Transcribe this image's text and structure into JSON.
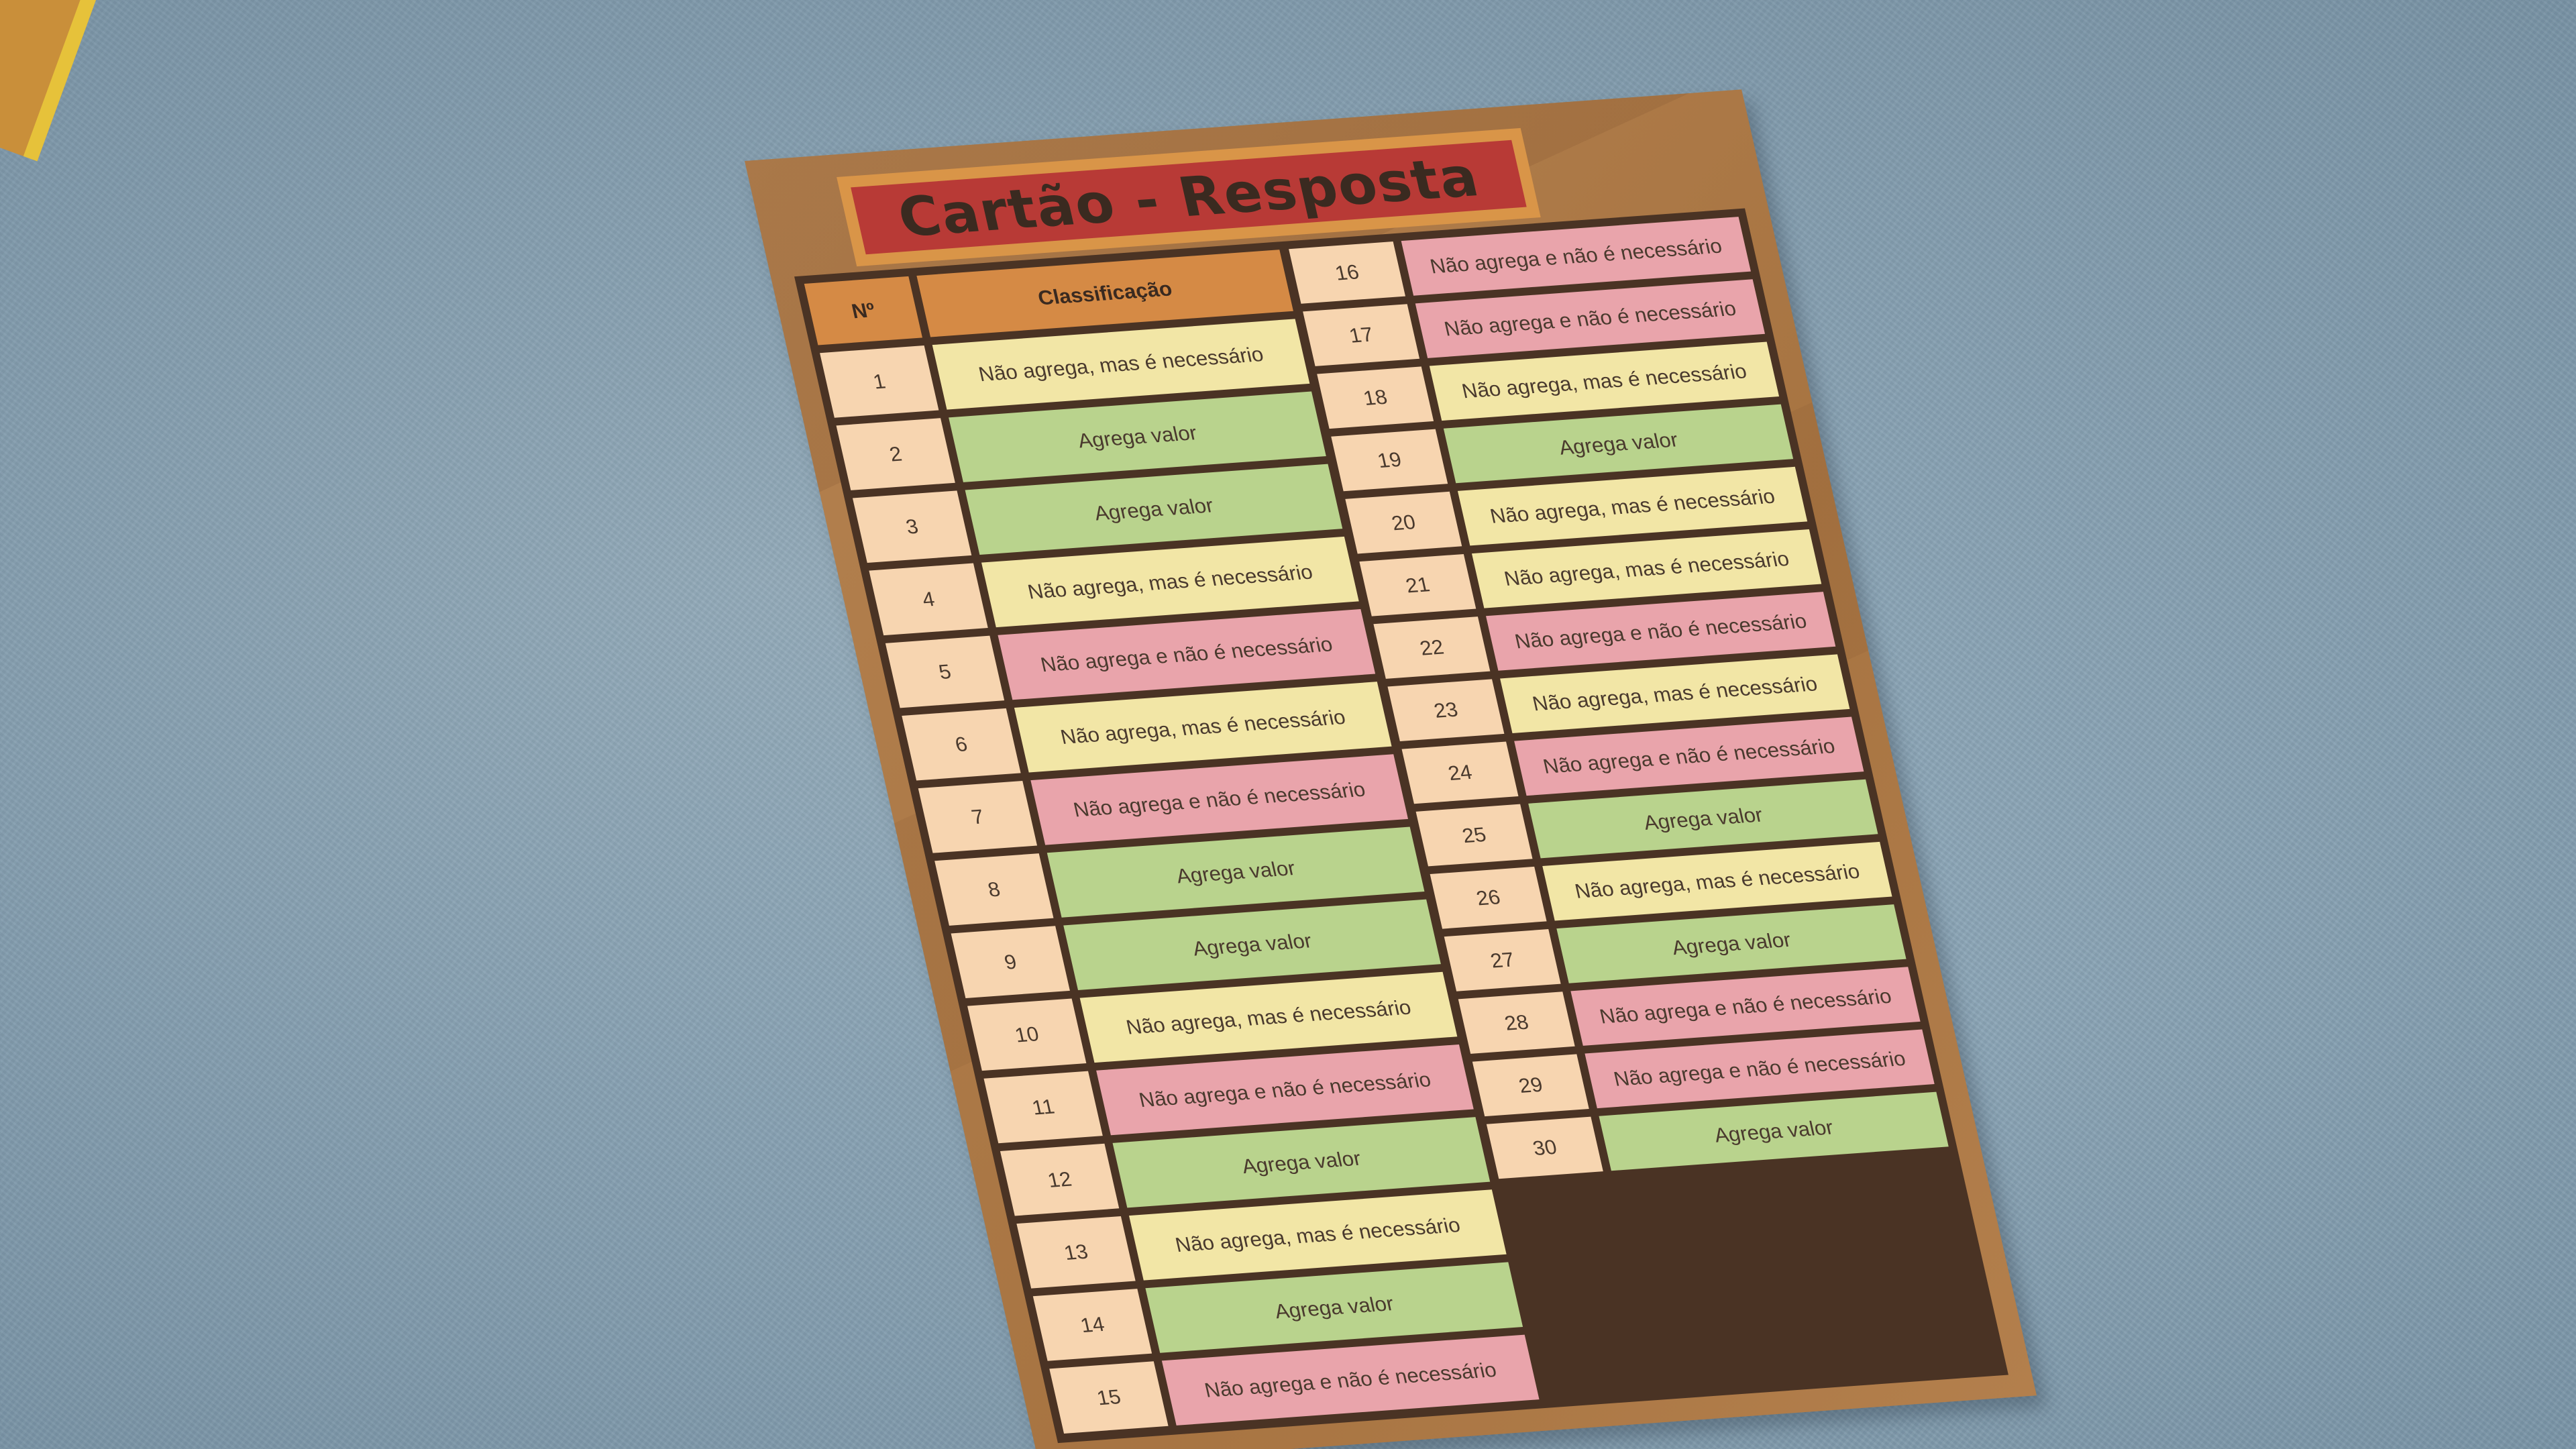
{
  "card": {
    "title": "Cartão - Resposta",
    "header_number": "Nº",
    "header_classification": "Classificação"
  },
  "categories": {
    "agrega": "Agrega valor",
    "nao_mas": "Não agrega, mas é necessário",
    "nao_nao": "Não agrega e não é necessário"
  },
  "rows_left": [
    {
      "n": "1",
      "label": "Não agrega, mas é necessário",
      "kind": "nao-mas"
    },
    {
      "n": "2",
      "label": "Agrega valor",
      "kind": "agrega"
    },
    {
      "n": "3",
      "label": "Agrega valor",
      "kind": "agrega"
    },
    {
      "n": "4",
      "label": "Não agrega, mas é necessário",
      "kind": "nao-mas"
    },
    {
      "n": "5",
      "label": "Não agrega e não é necessário",
      "kind": "nao-nao"
    },
    {
      "n": "6",
      "label": "Não agrega, mas é necessário",
      "kind": "nao-mas"
    },
    {
      "n": "7",
      "label": "Não agrega e não é necessário",
      "kind": "nao-nao"
    },
    {
      "n": "8",
      "label": "Agrega valor",
      "kind": "agrega"
    },
    {
      "n": "9",
      "label": "Agrega valor",
      "kind": "agrega"
    },
    {
      "n": "10",
      "label": "Não agrega, mas é necessário",
      "kind": "nao-mas"
    },
    {
      "n": "11",
      "label": "Não agrega e não é necessário",
      "kind": "nao-nao"
    },
    {
      "n": "12",
      "label": "Agrega valor",
      "kind": "agrega"
    },
    {
      "n": "13",
      "label": "Não agrega, mas é necessário",
      "kind": "nao-mas"
    },
    {
      "n": "14",
      "label": "Agrega valor",
      "kind": "agrega"
    },
    {
      "n": "15",
      "label": "Não agrega e não é necessário",
      "kind": "nao-nao"
    }
  ],
  "rows_right": [
    {
      "n": "16",
      "label": "Não agrega e não é necessário",
      "kind": "nao-nao"
    },
    {
      "n": "17",
      "label": "Não agrega e não é necessário",
      "kind": "nao-nao"
    },
    {
      "n": "18",
      "label": "Não agrega, mas é necessário",
      "kind": "nao-mas"
    },
    {
      "n": "19",
      "label": "Agrega valor",
      "kind": "agrega"
    },
    {
      "n": "20",
      "label": "Não agrega, mas é necessário",
      "kind": "nao-mas"
    },
    {
      "n": "21",
      "label": "Não agrega, mas é necessário",
      "kind": "nao-mas"
    },
    {
      "n": "22",
      "label": "Não agrega e não é necessário",
      "kind": "nao-nao"
    },
    {
      "n": "23",
      "label": "Não agrega, mas é necessário",
      "kind": "nao-mas"
    },
    {
      "n": "24",
      "label": "Não agrega e não é necessário",
      "kind": "nao-nao"
    },
    {
      "n": "25",
      "label": "Agrega valor",
      "kind": "agrega"
    },
    {
      "n": "26",
      "label": "Não agrega, mas é necessário",
      "kind": "nao-mas"
    },
    {
      "n": "27",
      "label": "Agrega valor",
      "kind": "agrega"
    },
    {
      "n": "28",
      "label": "Não agrega e não é necessário",
      "kind": "nao-nao"
    },
    {
      "n": "29",
      "label": "Não agrega e não é necessário",
      "kind": "nao-nao"
    },
    {
      "n": "30",
      "label": "Agrega valor",
      "kind": "agrega"
    }
  ],
  "colors": {
    "agrega": "#b9d38d",
    "nao_mas": "#f2e6a6",
    "nao_nao": "#e9a4ab",
    "number_cell": "#f7d5b0",
    "header": "#d58a45",
    "title_bg": "#b83a36",
    "paper": "#b07a45",
    "table_border": "#4a3324",
    "background_fabric": "#8fa9ba"
  }
}
